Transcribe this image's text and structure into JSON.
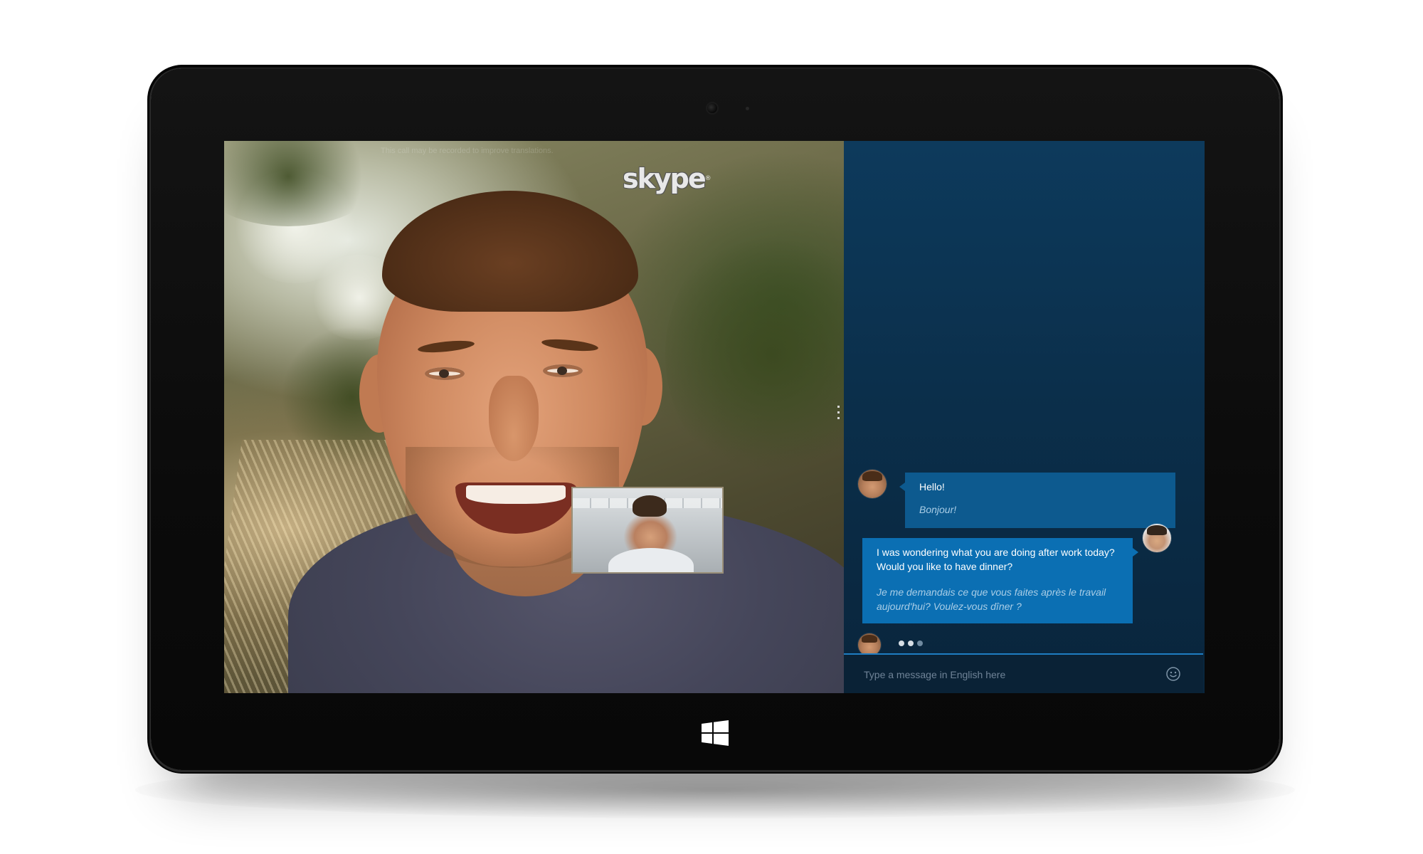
{
  "video": {
    "recording_notice": "This call may be recorded to improve translations.",
    "logo_text": "skype",
    "logo_mark": "®"
  },
  "chat": {
    "messages": [
      {
        "direction": "incoming",
        "original": "Hello!",
        "translation": "Bonjour!"
      },
      {
        "direction": "outgoing",
        "original": "I was wondering what you are doing after work today? Would you like to have dinner?",
        "translation": "Je me demandais ce que vous faites après le travail aujourd'hui? Voulez-vous dîner ?"
      }
    ],
    "typing_indicator": "remote-user-typing",
    "compose": {
      "placeholder": "Type a message in English here",
      "value": ""
    }
  },
  "icons": {
    "emoji": "smiley-icon",
    "start": "windows-logo-icon"
  },
  "colors": {
    "chat_background": "#0b2f4b",
    "incoming_bubble": "#0d5a8f",
    "outgoing_bubble": "#0b6fb3",
    "compose_border": "#1f7dc2"
  }
}
